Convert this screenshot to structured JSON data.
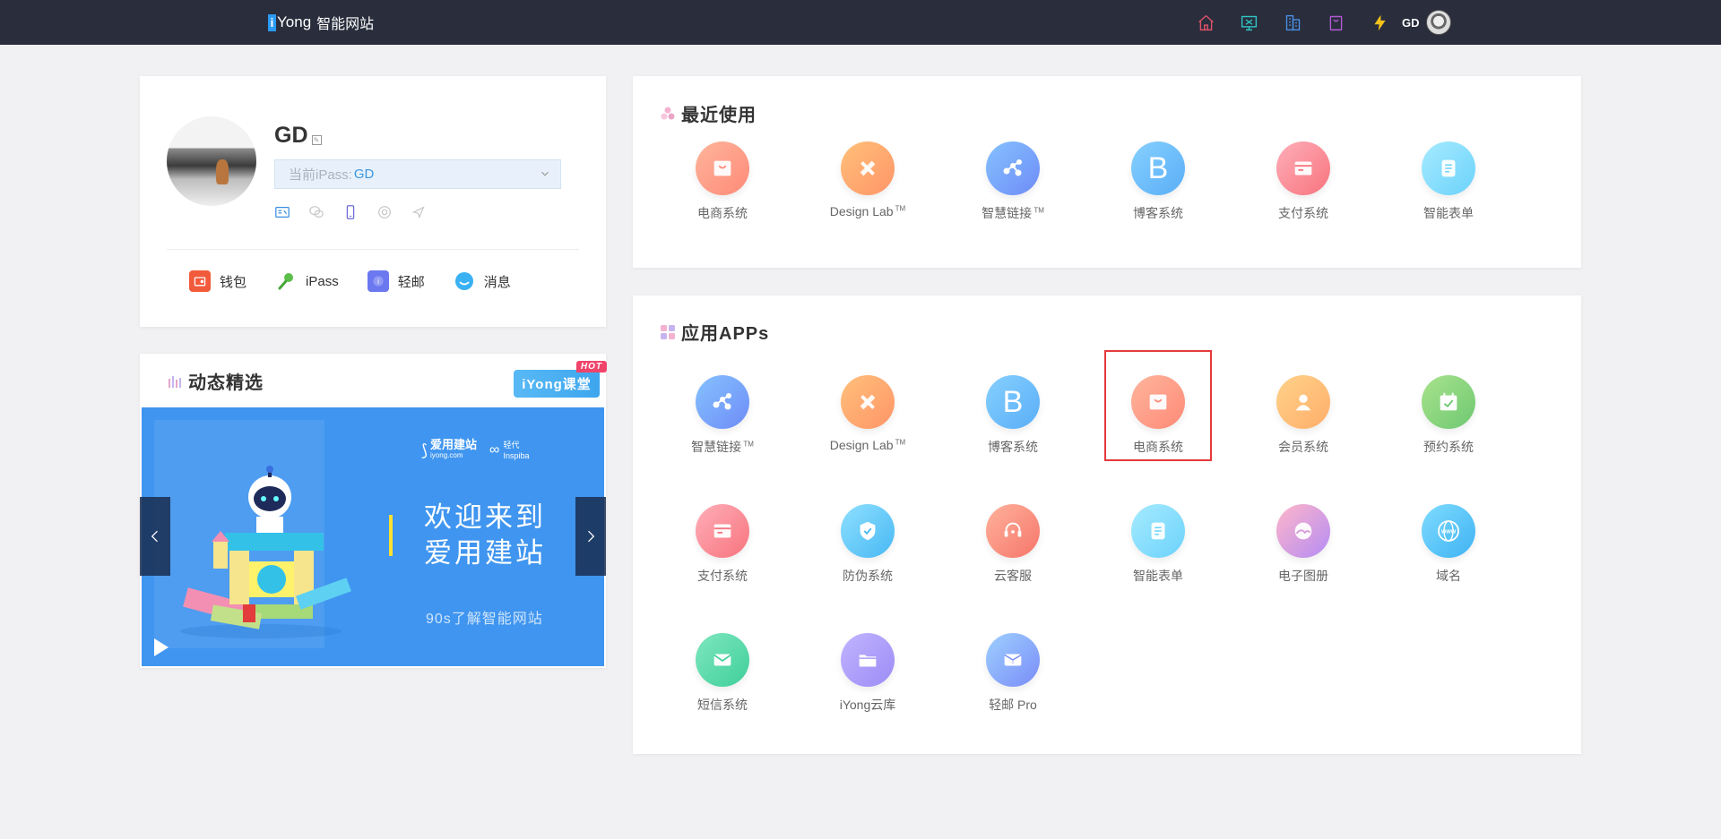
{
  "header": {
    "brand_letter": "i",
    "brand_name": "Yong",
    "brand_cn": "智能网站",
    "icons": [
      "home-icon",
      "monitor-icon",
      "building-icon",
      "bag-icon",
      "lightning-icon"
    ],
    "user": "GD"
  },
  "profile": {
    "name": "GD",
    "ipass_label": "当前iPass:",
    "ipass_value": "GD",
    "bind_icons": [
      "id-card-icon",
      "wechat-icon",
      "phone-icon",
      "email-icon",
      "location-icon"
    ],
    "shortcuts": [
      {
        "label": "钱包",
        "icon": "wallet-icon",
        "color": "#f25a3c"
      },
      {
        "label": "iPass",
        "icon": "key-icon",
        "color": "#5cbf4a"
      },
      {
        "label": "轻邮",
        "icon": "mail-icon",
        "color": "#6b78f0"
      },
      {
        "label": "消息",
        "icon": "chat-icon",
        "color": "#3ab1f3"
      }
    ]
  },
  "dynamics": {
    "title": "动态精选",
    "badge": "iYong课堂",
    "hot": "HOT",
    "banner_logo1": "爱用建站",
    "banner_logo1_sub": "iyong.com",
    "banner_logo2": "轻代",
    "banner_logo2_sub": "Inspiba",
    "headline1": "欢迎来到",
    "headline2": "爱用建站",
    "subline": "90s了解智能网站"
  },
  "recent": {
    "title": "最近使用",
    "apps": [
      {
        "label": "电商系统",
        "icon": "shop-bag-icon",
        "grad": [
          "#ffb59c",
          "#fd8a78"
        ]
      },
      {
        "label": "Design Lab",
        "tm": "TM",
        "icon": "pencil-ruler-icon",
        "grad": [
          "#ffc07a",
          "#ff9568"
        ]
      },
      {
        "label": "智慧链接",
        "tm": "TM",
        "icon": "network-icon",
        "grad": [
          "#85c2ff",
          "#6e8cf7"
        ]
      },
      {
        "label": "博客系统",
        "icon": "letter-b-icon",
        "glyph": "B",
        "grad": [
          "#86d0ff",
          "#5aaef7"
        ]
      },
      {
        "label": "支付系统",
        "icon": "payment-icon",
        "grad": [
          "#ffaeb8",
          "#f7747e"
        ]
      },
      {
        "label": "智能表单",
        "icon": "form-icon",
        "grad": [
          "#a6ebff",
          "#6cd2fb"
        ]
      }
    ]
  },
  "apps": {
    "title": "应用APPs",
    "selected_index": 3,
    "items": [
      {
        "label": "智慧链接",
        "tm": "TM",
        "icon": "network-icon",
        "grad": [
          "#85c2ff",
          "#6e8cf7"
        ]
      },
      {
        "label": "Design Lab",
        "tm": "TM",
        "icon": "pencil-ruler-icon",
        "grad": [
          "#ffc07a",
          "#ff9568"
        ]
      },
      {
        "label": "博客系统",
        "icon": "letter-b-icon",
        "glyph": "B",
        "grad": [
          "#86d0ff",
          "#5aaef7"
        ]
      },
      {
        "label": "电商系统",
        "icon": "shop-bag-icon",
        "grad": [
          "#ffb59c",
          "#fd8a78"
        ]
      },
      {
        "label": "会员系统",
        "icon": "member-icon",
        "grad": [
          "#ffd28a",
          "#ffae6a"
        ]
      },
      {
        "label": "预约系统",
        "icon": "calendar-icon",
        "grad": [
          "#a8e38c",
          "#6fc872"
        ]
      },
      {
        "label": "支付系统",
        "icon": "payment-icon",
        "grad": [
          "#ffaeb8",
          "#f7747e"
        ]
      },
      {
        "label": "防伪系统",
        "icon": "shield-icon",
        "grad": [
          "#8ee0ff",
          "#48b8f3"
        ]
      },
      {
        "label": "云客服",
        "icon": "headset-icon",
        "grad": [
          "#ffb29c",
          "#f5766a"
        ]
      },
      {
        "label": "智能表单",
        "icon": "form-icon",
        "grad": [
          "#a6ebff",
          "#6cd2fb"
        ]
      },
      {
        "label": "电子图册",
        "icon": "album-icon",
        "grad": [
          "#ffb6c8",
          "#b58cf5"
        ]
      },
      {
        "label": "域名",
        "icon": "globe-icon",
        "glyph": "www",
        "grad": [
          "#7fdcff",
          "#3fb2f3"
        ]
      },
      {
        "label": "短信系统",
        "icon": "sms-icon",
        "grad": [
          "#7fe7c0",
          "#3fcf9a"
        ]
      },
      {
        "label": "iYong云库",
        "icon": "folder-icon",
        "grad": [
          "#c2b4ff",
          "#9b8cf5"
        ]
      },
      {
        "label": "轻邮 Pro",
        "icon": "mail-icon",
        "grad": [
          "#9ed0ff",
          "#7a8cf7"
        ]
      }
    ]
  }
}
